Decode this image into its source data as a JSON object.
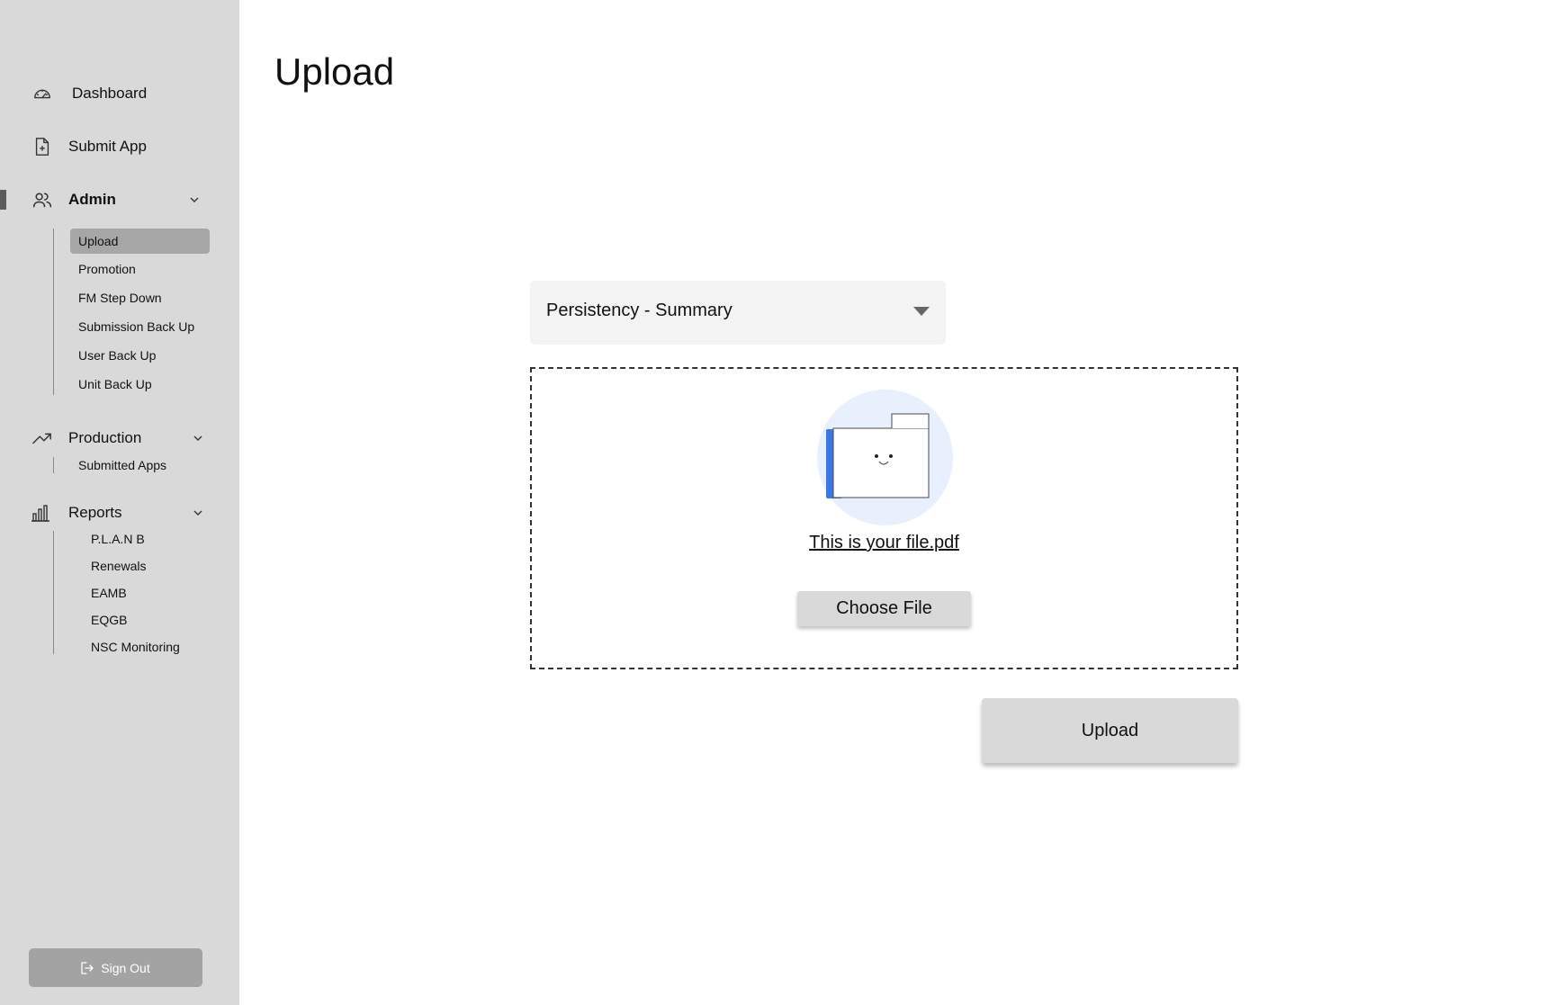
{
  "sidebar": {
    "nav": {
      "dashboard": "Dashboard",
      "submit_app": "Submit App",
      "admin": "Admin",
      "production": "Production",
      "reports": "Reports"
    },
    "admin_items": [
      "Upload",
      "Promotion",
      "FM Step Down",
      "Submission Back Up",
      "User Back Up",
      "Unit Back Up"
    ],
    "production_items": [
      "Submitted Apps"
    ],
    "reports_items": [
      "P.L.A.N B",
      "Renewals",
      "EAMB",
      "EQGB",
      "NSC Monitoring"
    ],
    "active_item": "Upload",
    "sign_out": "Sign Out"
  },
  "main": {
    "title": "Upload",
    "report_select": {
      "selected": "Persistency - Summary"
    },
    "dropzone": {
      "file_name": "This is your file.pdf",
      "choose_label": "Choose File"
    },
    "upload_label": "Upload"
  },
  "colors": {
    "sidebar_bg": "#d9d9d9",
    "active_sub_bg": "#a6a6a6",
    "signout_bg": "#a3a3a3",
    "folder_accent": "#3b78e7",
    "folder_circle": "#e8f0fe"
  },
  "icons": {
    "dashboard": "gauge-icon",
    "submit_app": "file-plus-icon",
    "admin": "users-icon",
    "production": "trending-up-icon",
    "reports": "bar-chart-icon",
    "sign_out": "logout-icon",
    "dropzone": "folder-icon"
  }
}
